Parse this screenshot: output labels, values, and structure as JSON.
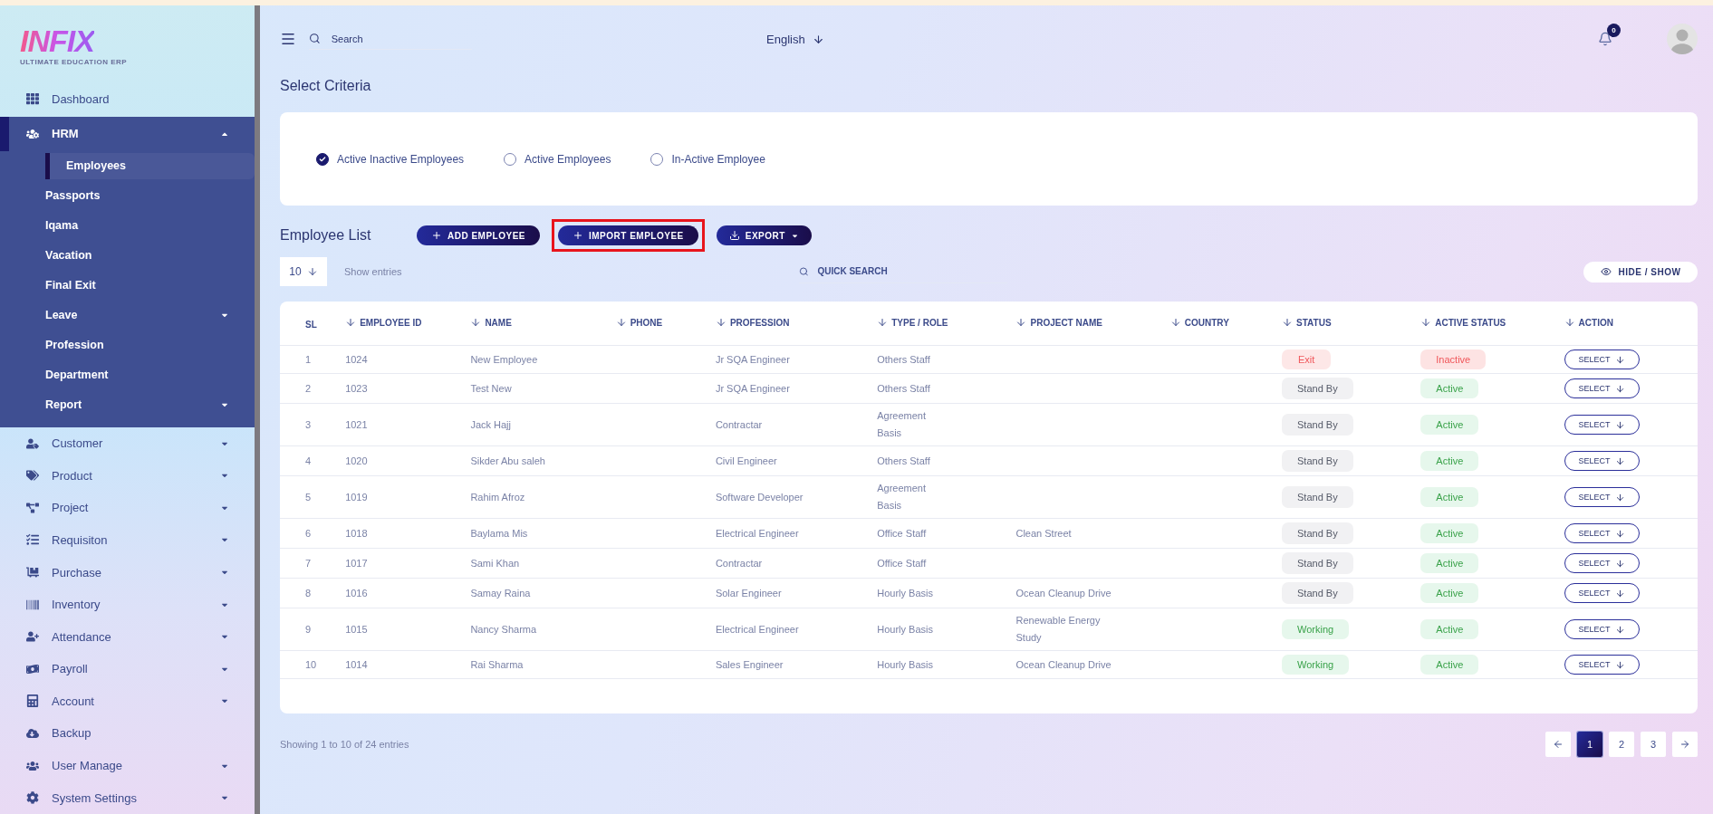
{
  "logo": {
    "name": "INFIX",
    "tagline": "ULTIMATE EDUCATION ERP"
  },
  "sidebar": {
    "items": [
      {
        "label": "Dashboard",
        "selected": false,
        "dropdown": false
      },
      {
        "label": "HRM",
        "selected": true,
        "dropdown": true,
        "expanded": true,
        "children": [
          {
            "label": "Employees",
            "selected": true,
            "dropdown": false
          },
          {
            "label": "Passports",
            "selected": false,
            "dropdown": false
          },
          {
            "label": "Iqama",
            "selected": false,
            "dropdown": false
          },
          {
            "label": "Vacation",
            "selected": false,
            "dropdown": false
          },
          {
            "label": "Final Exit",
            "selected": false,
            "dropdown": false
          },
          {
            "label": "Leave",
            "selected": false,
            "dropdown": true
          },
          {
            "label": "Profession",
            "selected": false,
            "dropdown": false
          },
          {
            "label": "Department",
            "selected": false,
            "dropdown": false
          },
          {
            "label": "Report",
            "selected": false,
            "dropdown": true
          }
        ]
      },
      {
        "label": "Customer",
        "selected": false,
        "dropdown": true,
        "expanded": false
      },
      {
        "label": "Product",
        "selected": false,
        "dropdown": true,
        "expanded": false
      },
      {
        "label": "Project",
        "selected": false,
        "dropdown": true,
        "expanded": false
      },
      {
        "label": "Requisiton",
        "selected": false,
        "dropdown": true,
        "expanded": false
      },
      {
        "label": "Purchase",
        "selected": false,
        "dropdown": true,
        "expanded": false
      },
      {
        "label": "Inventory",
        "selected": false,
        "dropdown": true,
        "expanded": false
      },
      {
        "label": "Attendance",
        "selected": false,
        "dropdown": true,
        "expanded": false
      },
      {
        "label": "Payroll",
        "selected": false,
        "dropdown": true,
        "expanded": false
      },
      {
        "label": "Account",
        "selected": false,
        "dropdown": true,
        "expanded": false
      },
      {
        "label": "Backup",
        "selected": false,
        "dropdown": false
      },
      {
        "label": "User Manage",
        "selected": false,
        "dropdown": true,
        "expanded": false
      },
      {
        "label": "System Settings",
        "selected": false,
        "dropdown": true,
        "expanded": false
      }
    ]
  },
  "header": {
    "search": {
      "placeholder": "Search"
    },
    "language": "English",
    "notifications": "0"
  },
  "criteria": {
    "title": "Select Criteria",
    "options": [
      {
        "label": "Active Inactive Employees",
        "selected": true
      },
      {
        "label": "Active Employees",
        "selected": false
      },
      {
        "label": "In-Active Employee",
        "selected": false
      }
    ]
  },
  "employee_list": {
    "title": "Employee List",
    "buttons": [
      {
        "label": "ADD EMPLOYEE",
        "kind": "add",
        "highlighted": false
      },
      {
        "label": "IMPORT EMPLOYEE",
        "kind": "add",
        "highlighted": true
      },
      {
        "label": "EXPORT",
        "kind": "export",
        "highlighted": false
      }
    ],
    "page_size": "10",
    "page_size_label": "Show entries",
    "quick_search": {
      "placeholder": "QUICK SEARCH"
    },
    "hide_show": "HIDE / SHOW"
  },
  "table": {
    "columns": [
      {
        "label": "SL",
        "sortable": false
      },
      {
        "label": "EMPLOYEE ID",
        "sortable": true
      },
      {
        "label": "NAME",
        "sortable": true
      },
      {
        "label": "PHONE",
        "sortable": true
      },
      {
        "label": "PROFESSION",
        "sortable": true
      },
      {
        "label": "TYPE / ROLE",
        "sortable": true
      },
      {
        "label": "PROJECT NAME",
        "sortable": true
      },
      {
        "label": "COUNTRY",
        "sortable": true
      },
      {
        "label": "STATUS",
        "sortable": true
      },
      {
        "label": "ACTIVE STATUS",
        "sortable": true
      },
      {
        "label": "ACTION",
        "sortable": true
      }
    ],
    "rows": [
      {
        "sl": "1",
        "id": "1024",
        "name": "New Employee",
        "profession": "Jr SQA Engineer",
        "type": "Others Staff",
        "status": {
          "text": "Exit",
          "kind": "exit"
        },
        "active_status": {
          "text": "Inactive",
          "kind": "inactive"
        },
        "action": "SELECT"
      },
      {
        "sl": "2",
        "id": "1023",
        "name": "Test New",
        "profession": "Jr SQA Engineer",
        "type": "Others Staff",
        "status": {
          "text": "Stand By",
          "kind": "standby"
        },
        "active_status": {
          "text": "Active",
          "kind": "active"
        },
        "action": "SELECT"
      },
      {
        "sl": "3",
        "id": "1021",
        "name": "Jack Hajj",
        "profession": "Contractar",
        "type": "Agreement Basis",
        "status": {
          "text": "Stand By",
          "kind": "standby"
        },
        "active_status": {
          "text": "Active",
          "kind": "active"
        },
        "action": "SELECT"
      },
      {
        "sl": "4",
        "id": "1020",
        "name": "Sikder Abu saleh",
        "profession": "Civil Engineer",
        "type": "Others Staff",
        "status": {
          "text": "Stand By",
          "kind": "standby"
        },
        "active_status": {
          "text": "Active",
          "kind": "active"
        },
        "action": "SELECT"
      },
      {
        "sl": "5",
        "id": "1019",
        "name": "Rahim Afroz",
        "profession": "Software Developer",
        "type": "Agreement Basis",
        "status": {
          "text": "Stand By",
          "kind": "standby"
        },
        "active_status": {
          "text": "Active",
          "kind": "active"
        },
        "action": "SELECT"
      },
      {
        "sl": "6",
        "id": "1018",
        "name": "Baylama Mis",
        "profession": "Electrical Engineer",
        "type": "Office Staff",
        "project": "Clean Street",
        "status": {
          "text": "Stand By",
          "kind": "standby"
        },
        "active_status": {
          "text": "Active",
          "kind": "active"
        },
        "action": "SELECT"
      },
      {
        "sl": "7",
        "id": "1017",
        "name": "Sami Khan",
        "profession": "Contractar",
        "type": "Office Staff",
        "status": {
          "text": "Stand By",
          "kind": "standby"
        },
        "active_status": {
          "text": "Active",
          "kind": "active"
        },
        "action": "SELECT"
      },
      {
        "sl": "8",
        "id": "1016",
        "name": "Samay Raina",
        "profession": "Solar Engineer",
        "type": "Hourly Basis",
        "project": "Ocean Cleanup Drive",
        "status": {
          "text": "Stand By",
          "kind": "standby"
        },
        "active_status": {
          "text": "Active",
          "kind": "active"
        },
        "action": "SELECT"
      },
      {
        "sl": "9",
        "id": "1015",
        "name": "Nancy Sharma",
        "profession": "Electrical Engineer",
        "type": "Hourly Basis",
        "project": "Renewable Energy Study",
        "status": {
          "text": "Working",
          "kind": "working"
        },
        "active_status": {
          "text": "Active",
          "kind": "active"
        },
        "action": "SELECT"
      },
      {
        "sl": "10",
        "id": "1014",
        "name": "Rai Sharma",
        "profession": "Sales Engineer",
        "type": "Hourly Basis",
        "project": "Ocean Cleanup Drive",
        "status": {
          "text": "Working",
          "kind": "working"
        },
        "active_status": {
          "text": "Active",
          "kind": "active"
        },
        "action": "SELECT"
      }
    ]
  },
  "footer": {
    "summary": "Showing 1 to 10 of 24 entries",
    "pages": [
      {
        "label": "1",
        "selected": true
      },
      {
        "label": "2",
        "selected": false
      },
      {
        "label": "3",
        "selected": false
      }
    ]
  }
}
